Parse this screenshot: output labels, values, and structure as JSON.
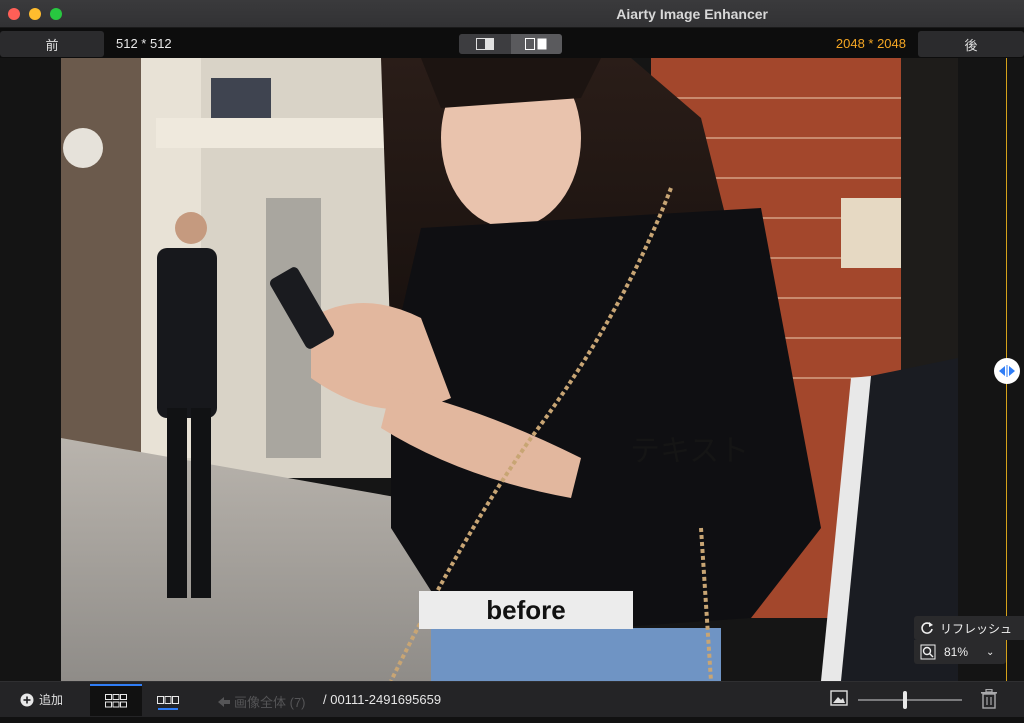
{
  "window": {
    "title": "Aiarty Image Enhancer"
  },
  "toolbar": {
    "prev_label": "前",
    "next_label": "後",
    "source_size": "512 * 512",
    "output_size": "2048 * 2048"
  },
  "stage": {
    "before_label": "before",
    "overlay_text": "テキスト",
    "refresh_label": "リフレッシュ",
    "zoom_value": "81%"
  },
  "bottombar": {
    "add_label": "追加",
    "back_all_label": "画像全体 (7)",
    "path": "/ 00111-2491695659",
    "thumbnail_size_level": 0.45
  },
  "colors": {
    "accent_orange": "#f5a623",
    "accent_blue": "#2f7df6",
    "divider": "#d5a21a"
  }
}
